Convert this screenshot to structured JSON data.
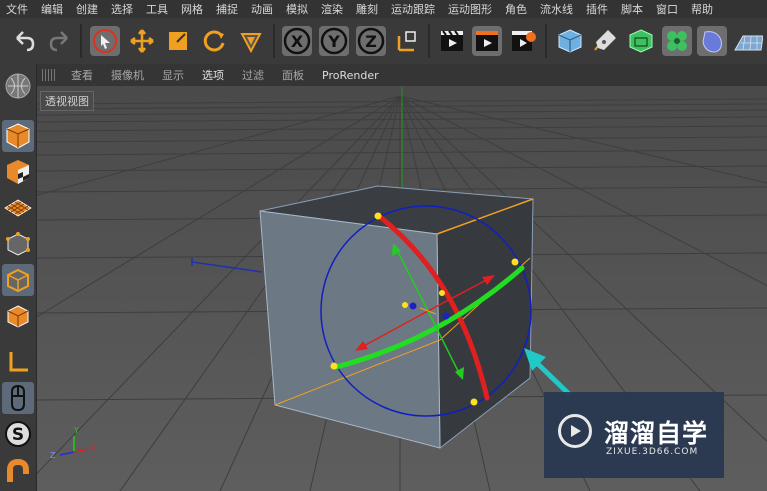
{
  "menu": [
    "文件",
    "编辑",
    "创建",
    "选择",
    "工具",
    "网格",
    "捕捉",
    "动画",
    "模拟",
    "渲染",
    "雕刻",
    "运动跟踪",
    "运动图形",
    "角色",
    "流水线",
    "插件",
    "脚本",
    "窗口",
    "帮助"
  ],
  "toolbar_icons": [
    "undo-icon",
    "redo-icon",
    "live-select-icon",
    "move-icon",
    "scale-icon",
    "rotate-icon",
    "last-tool-icon",
    "x-axis-lock-icon",
    "y-axis-lock-icon",
    "z-axis-lock-icon",
    "coordinate-system-icon",
    "render-view-icon",
    "render-picture-viewer-icon",
    "render-settings-icon",
    "cube-primitive-icon",
    "pen-spline-icon",
    "subdivision-icon",
    "cloner-icon",
    "deformer-icon",
    "floor-environment-icon"
  ],
  "axis_letters": {
    "x": "X",
    "y": "Y",
    "z": "Z"
  },
  "left_tools": [
    "make-editable-icon",
    "model-mode-icon",
    "texture-mode-icon",
    "workplane-mode-icon",
    "points-mode-icon",
    "edges-mode-icon",
    "polygons-mode-icon",
    "axis-mode-icon",
    "tweak-mode-icon",
    "snapping-icon",
    "magnet-icon"
  ],
  "viewport_menu": [
    "查看",
    "摄像机",
    "显示",
    "选项",
    "过滤",
    "面板",
    "ProRender"
  ],
  "viewport_menu_active": "选项",
  "viewport_label": "透视视图",
  "axis_gizmo": {
    "x": "X",
    "y": "Y",
    "z": "Z"
  },
  "watermark": {
    "title": "溜溜自学",
    "url": "ZIXUE.3D66.COM"
  },
  "colors": {
    "red_ring": "#e02020",
    "green_ring": "#22dd22",
    "blue_circle": "#1020c0",
    "arrow": "#20c8c8",
    "handle": "#ffe020"
  }
}
